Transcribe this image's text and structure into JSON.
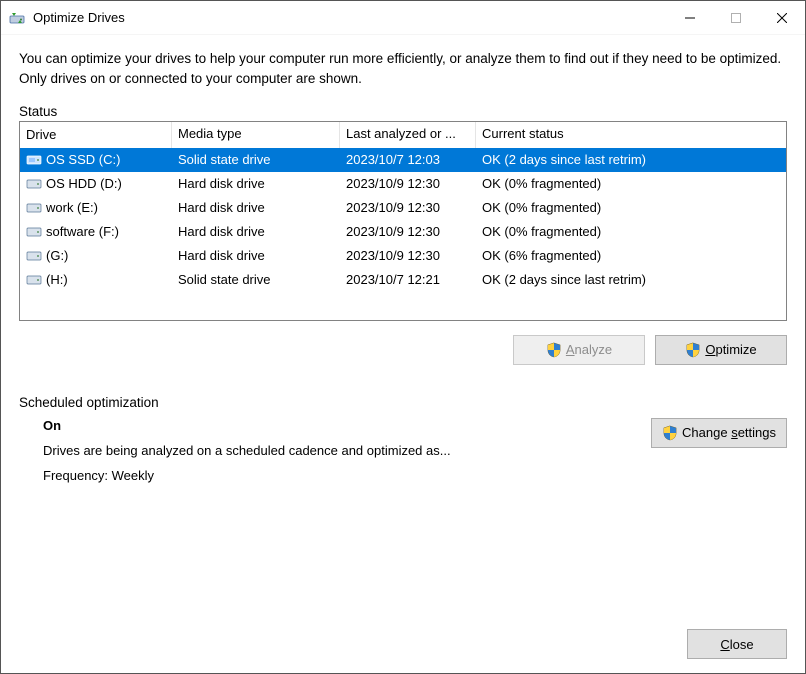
{
  "window": {
    "title": "Optimize Drives"
  },
  "description": "You can optimize your drives to help your computer run more efficiently, or analyze them to find out if they need to be optimized. Only drives on or connected to your computer are shown.",
  "status_label": "Status",
  "columns": {
    "drive": "Drive",
    "media": "Media type",
    "last": "Last analyzed or ...",
    "status": "Current status"
  },
  "drives": [
    {
      "name": "OS SSD (C:)",
      "icon": "ssd",
      "media": "Solid state drive",
      "last": "2023/10/7 12:03",
      "status": "OK (2 days since last retrim)",
      "selected": true
    },
    {
      "name": "OS HDD (D:)",
      "icon": "hdd",
      "media": "Hard disk drive",
      "last": "2023/10/9 12:30",
      "status": "OK (0% fragmented)",
      "selected": false
    },
    {
      "name": "work (E:)",
      "icon": "hdd",
      "media": "Hard disk drive",
      "last": "2023/10/9 12:30",
      "status": "OK (0% fragmented)",
      "selected": false
    },
    {
      "name": "software (F:)",
      "icon": "hdd",
      "media": "Hard disk drive",
      "last": "2023/10/9 12:30",
      "status": "OK (0% fragmented)",
      "selected": false
    },
    {
      "name": "(G:)",
      "icon": "hdd",
      "media": "Hard disk drive",
      "last": "2023/10/9 12:30",
      "status": "OK (6% fragmented)",
      "selected": false
    },
    {
      "name": "(H:)",
      "icon": "hdd",
      "media": "Solid state drive",
      "last": "2023/10/7 12:21",
      "status": "OK (2 days since last retrim)",
      "selected": false
    }
  ],
  "buttons": {
    "analyze_pre": "",
    "analyze_ak": "A",
    "analyze_post": "nalyze",
    "optimize_pre": "",
    "optimize_ak": "O",
    "optimize_post": "ptimize",
    "change_pre": "Change ",
    "change_ak": "s",
    "change_post": "ettings",
    "close_pre": "",
    "close_ak": "C",
    "close_post": "lose"
  },
  "scheduled": {
    "label": "Scheduled optimization",
    "on": "On",
    "line": "Drives are being analyzed on a scheduled cadence and optimized as...",
    "freq": "Frequency: Weekly"
  }
}
